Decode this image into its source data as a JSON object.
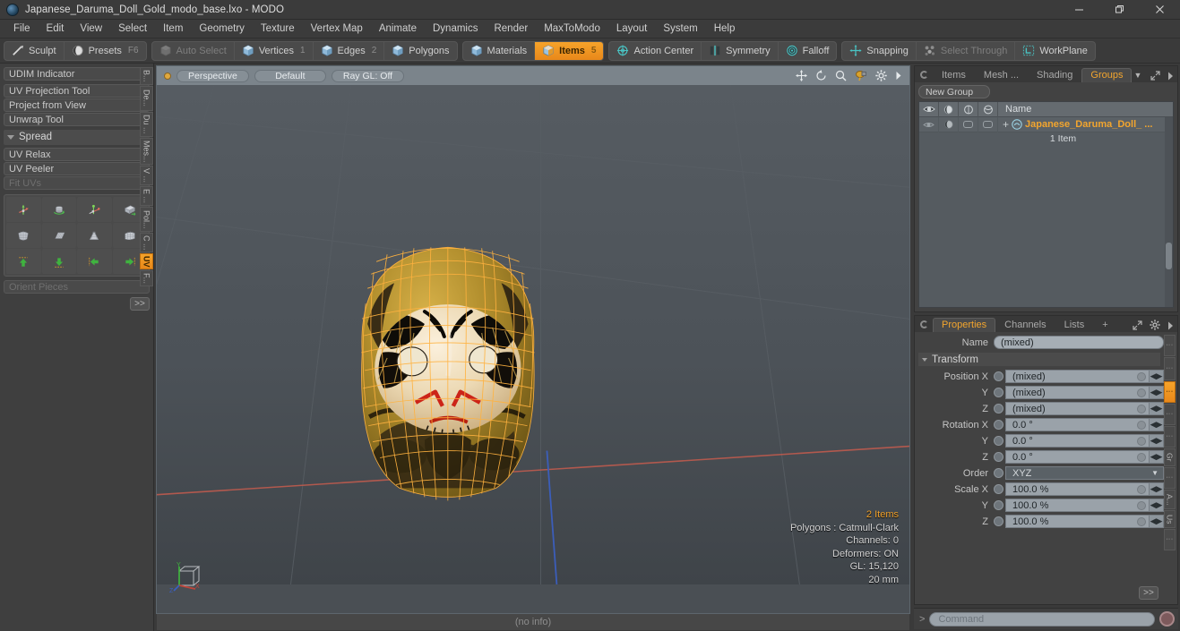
{
  "window": {
    "title": "Japanese_Daruma_Doll_Gold_modo_base.lxo - MODO",
    "app_icon": "modo-logo-icon",
    "minimize": "minimize-icon",
    "maximize": "maximize-icon",
    "close": "close-icon"
  },
  "menubar": {
    "items": [
      {
        "label": "File"
      },
      {
        "label": "Edit"
      },
      {
        "label": "View"
      },
      {
        "label": "Select"
      },
      {
        "label": "Item"
      },
      {
        "label": "Geometry"
      },
      {
        "label": "Texture"
      },
      {
        "label": "Vertex Map"
      },
      {
        "label": "Animate"
      },
      {
        "label": "Dynamics"
      },
      {
        "label": "Render"
      },
      {
        "label": "MaxToModo"
      },
      {
        "label": "Layout"
      },
      {
        "label": "System"
      },
      {
        "label": "Help"
      }
    ]
  },
  "toolbar": {
    "groups": [
      {
        "buttons": [
          {
            "label": "Sculpt",
            "icon": "brush-icon",
            "state": "normal",
            "badge": ""
          },
          {
            "label": "Presets",
            "icon": "sphere-half-icon",
            "state": "normal",
            "badge": "F6"
          }
        ]
      },
      {
        "buttons": [
          {
            "label": "Auto Select",
            "icon": "cube-grey-icon",
            "state": "dim",
            "badge": ""
          },
          {
            "label": "Vertices",
            "icon": "cube-blue-icon",
            "state": "normal",
            "badge": "1"
          },
          {
            "label": "Edges",
            "icon": "cube-blue-icon",
            "state": "normal",
            "badge": "2"
          },
          {
            "label": "Polygons",
            "icon": "cube-blue-icon",
            "state": "normal",
            "badge": ""
          }
        ]
      },
      {
        "buttons": [
          {
            "label": "Materials",
            "icon": "cube-blue-icon",
            "state": "normal",
            "badge": ""
          },
          {
            "label": "Items",
            "icon": "cube-orange-icon",
            "state": "active",
            "badge": "5"
          }
        ]
      },
      {
        "buttons": [
          {
            "label": "Action Center",
            "icon": "crosshair-circle-icon",
            "state": "normal",
            "badge": ""
          },
          {
            "label": "Symmetry",
            "icon": "symmetry-icon",
            "state": "normal",
            "badge": ""
          },
          {
            "label": "Falloff",
            "icon": "falloff-circle-icon",
            "state": "normal",
            "badge": ""
          }
        ]
      },
      {
        "buttons": [
          {
            "label": "Snapping",
            "icon": "snap-cross-icon",
            "state": "normal",
            "badge": ""
          },
          {
            "label": "Select Through",
            "icon": "select-through-icon",
            "state": "dim",
            "badge": ""
          },
          {
            "label": "WorkPlane",
            "icon": "workplane-icon",
            "state": "normal",
            "badge": ""
          }
        ]
      }
    ]
  },
  "left_panel": {
    "rows_top": [
      {
        "label": "UDIM Indicator",
        "state": "normal"
      }
    ],
    "rows_mid": [
      {
        "label": "UV Projection Tool",
        "state": "normal"
      },
      {
        "label": "Project from View",
        "state": "normal"
      },
      {
        "label": "Unwrap Tool",
        "state": "normal"
      }
    ],
    "section_header": "Spread",
    "rows_bottom": [
      {
        "label": "UV Relax",
        "state": "normal"
      },
      {
        "label": "UV Peeler",
        "state": "normal"
      },
      {
        "label": "Fit UVs",
        "state": "dim"
      }
    ],
    "icon_tools": [
      {
        "name": "uv-transform-tool-icon"
      },
      {
        "name": "uv-cylinder-rotate-icon"
      },
      {
        "name": "uv-move-axis-icon"
      },
      {
        "name": "uv-box-flatten-icon"
      },
      {
        "name": "uv-shell-icon"
      },
      {
        "name": "uv-grid-flat-icon"
      },
      {
        "name": "uv-cone-unwrap-icon"
      },
      {
        "name": "uv-sphere-grid-icon"
      },
      {
        "name": "uv-align-up-icon"
      },
      {
        "name": "uv-align-down-icon"
      },
      {
        "name": "uv-align-left-icon"
      },
      {
        "name": "uv-align-right-icon"
      }
    ],
    "orient_pieces": "Orient Pieces",
    "more_button": ">>",
    "vtabs": [
      {
        "label": "B...",
        "active": false
      },
      {
        "label": "De...",
        "active": false
      },
      {
        "label": "Du ...",
        "active": false
      },
      {
        "label": "Mes...",
        "active": false
      },
      {
        "label": "V ...",
        "active": false
      },
      {
        "label": "E ...",
        "active": false
      },
      {
        "label": "Pol...",
        "active": false
      },
      {
        "label": "C ...",
        "active": false
      },
      {
        "label": "UV",
        "active": true
      },
      {
        "label": "F...",
        "active": false
      }
    ]
  },
  "viewport": {
    "header": {
      "indicator": "viewport-active-dot",
      "pills": [
        {
          "label": "Perspective"
        },
        {
          "label": "Default"
        },
        {
          "label": "Ray GL: Off"
        }
      ],
      "icons": [
        {
          "name": "pan-icon"
        },
        {
          "name": "rotate-icon"
        },
        {
          "name": "zoom-icon"
        },
        {
          "name": "lasso-select-icon"
        },
        {
          "name": "gear-icon"
        },
        {
          "name": "chevron-right-icon"
        }
      ]
    },
    "info": {
      "items": "2 Items",
      "polygons": "Polygons : Catmull-Clark",
      "channels": "Channels: 0",
      "deformers": "Deformers: ON",
      "gl": "GL: 15,120",
      "scale": "20 mm"
    },
    "gizmo": "axis-gizmo-icon",
    "model": "japanese-daruma-doll-gold-wireframe"
  },
  "statusbar": {
    "text": "(no info)"
  },
  "right_panel": {
    "top": {
      "tabs": [
        {
          "label": "Items",
          "active": false
        },
        {
          "label": "Mesh ...",
          "active": false
        },
        {
          "label": "Shading",
          "active": false
        },
        {
          "label": "Groups",
          "active": true
        }
      ],
      "dropdown_icon": "chevron-down-icon",
      "expand_icon": "expand-icon",
      "overflow_icon": "chevron-right-icon",
      "new_group_button": "New Group",
      "columns": [
        {
          "name": "eye-visibility-icon"
        },
        {
          "name": "render-sphere-icon"
        },
        {
          "name": "wireframe-toggle-icon"
        },
        {
          "name": "shading-toggle-icon"
        },
        {
          "name": "Name"
        }
      ],
      "rows": [
        {
          "name": "Japanese_Daruma_Doll_ ...",
          "subtitle": "1 Item",
          "expander": "+",
          "item_icon": "group-item-icon"
        }
      ]
    },
    "properties": {
      "tabs": [
        {
          "label": "Properties",
          "active": true
        },
        {
          "label": "Channels",
          "active": false
        },
        {
          "label": "Lists",
          "active": false
        },
        {
          "label": "+",
          "active": false
        }
      ],
      "expand_icon": "expand-icon",
      "gear_icon": "gear-icon",
      "overflow_icon": "chevron-right-icon",
      "name_label": "Name",
      "name_value": "(mixed)",
      "transform_header": "Transform",
      "fields": [
        {
          "label": "Position X",
          "value": "(mixed)",
          "type": "number"
        },
        {
          "label": "Y",
          "value": "(mixed)",
          "type": "number"
        },
        {
          "label": "Z",
          "value": "(mixed)",
          "type": "number"
        },
        {
          "label": "Rotation X",
          "value": "0.0 °",
          "type": "number"
        },
        {
          "label": "Y",
          "value": "0.0 °",
          "type": "number"
        },
        {
          "label": "Z",
          "value": "0.0 °",
          "type": "number"
        },
        {
          "label": "Order",
          "value": "XYZ",
          "type": "select"
        },
        {
          "label": "Scale X",
          "value": "100.0 %",
          "type": "number"
        },
        {
          "label": "Y",
          "value": "100.0 %",
          "type": "number"
        },
        {
          "label": "Z",
          "value": "100.0 %",
          "type": "number"
        }
      ],
      "more_button": ">>",
      "vtabs": [
        {
          "label": "⋮",
          "active": false
        },
        {
          "label": "⋮",
          "active": false
        },
        {
          "label": "⋮",
          "active": true
        },
        {
          "label": "⋮",
          "active": false
        },
        {
          "label": "⋮",
          "active": false
        },
        {
          "label": "Gr",
          "active": false
        },
        {
          "label": "⋮",
          "active": false
        },
        {
          "label": "A...",
          "active": false
        },
        {
          "label": "Us",
          "active": false
        },
        {
          "label": "⋮",
          "active": false
        }
      ]
    }
  },
  "command_bar": {
    "prompt": ">",
    "placeholder": "Command",
    "record_button": "record-macro-icon"
  }
}
